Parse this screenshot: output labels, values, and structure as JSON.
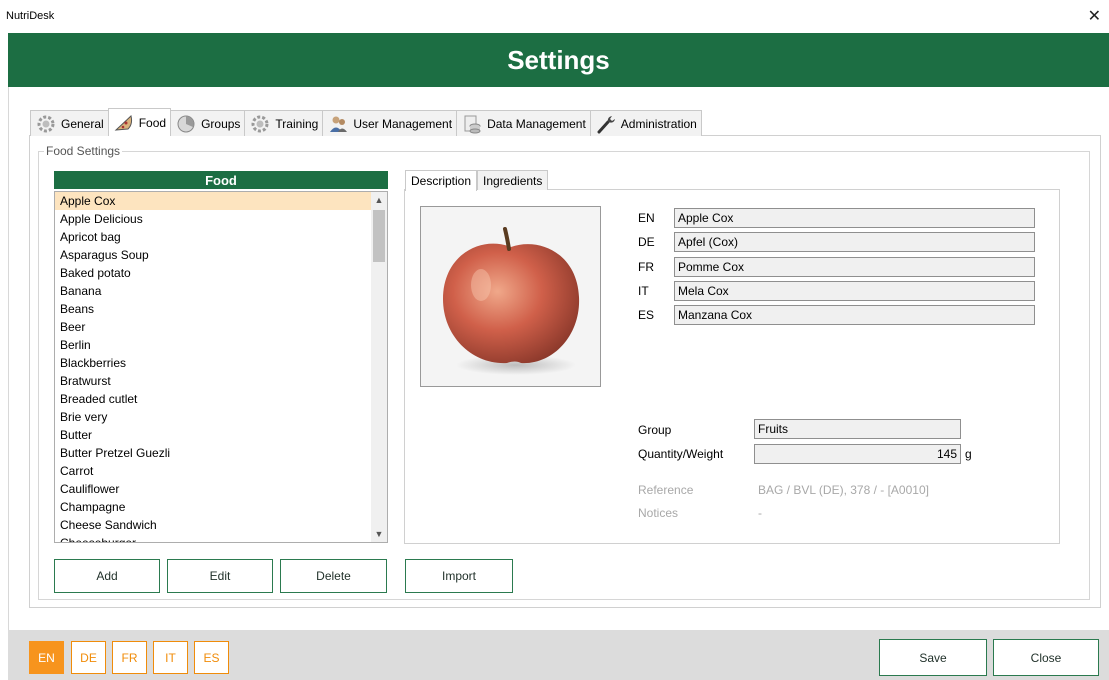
{
  "window": {
    "title": "NutriDesk",
    "close_glyph": "✕"
  },
  "header": {
    "title": "Settings"
  },
  "tabs": [
    {
      "label": "General",
      "icon": "gear-icon"
    },
    {
      "label": "Food",
      "icon": "pizza-icon"
    },
    {
      "label": "Groups",
      "icon": "pie-chart-icon"
    },
    {
      "label": "Training",
      "icon": "gear-icon"
    },
    {
      "label": "User Management",
      "icon": "users-icon"
    },
    {
      "label": "Data Management",
      "icon": "database-icon"
    },
    {
      "label": "Administration",
      "icon": "wrench-icon"
    }
  ],
  "active_tab": "Food",
  "food_settings": {
    "legend": "Food Settings",
    "list_header": "Food",
    "items": [
      "Apple Cox",
      "Apple Delicious",
      "Apricot bag",
      "Asparagus Soup",
      "Baked potato",
      "Banana",
      "Beans",
      "Beer",
      "Berlin",
      "Blackberries",
      "Bratwurst",
      "Breaded cutlet",
      "Brie very",
      "Butter",
      "Butter Pretzel Guezli",
      "Carrot",
      "Cauliflower",
      "Champagne",
      "Cheese Sandwich",
      "Cheeseburger"
    ],
    "selected_item": "Apple Cox",
    "buttons": {
      "add": "Add",
      "edit": "Edit",
      "delete": "Delete",
      "import": "Import"
    }
  },
  "detail": {
    "subtabs": [
      "Description",
      "Ingredients"
    ],
    "active_subtab": "Description",
    "names": [
      {
        "lang": "EN",
        "value": "Apple Cox"
      },
      {
        "lang": "DE",
        "value": "Apfel (Cox)"
      },
      {
        "lang": "FR",
        "value": "Pomme Cox"
      },
      {
        "lang": "IT",
        "value": "Mela Cox"
      },
      {
        "lang": "ES",
        "value": "Manzana Cox"
      }
    ],
    "group_label": "Group",
    "group_value": "Fruits",
    "quantity_label": "Quantity/Weight",
    "quantity_value": "145",
    "quantity_unit": "g",
    "reference_label": "Reference",
    "reference_value": "BAG / BVL (DE), 378 / - [A0010]",
    "notices_label": "Notices",
    "notices_value": "-"
  },
  "footer": {
    "languages": [
      "EN",
      "DE",
      "FR",
      "IT",
      "ES"
    ],
    "active_language": "EN",
    "save": "Save",
    "close": "Close"
  },
  "colors": {
    "brand_green": "#1c6e43",
    "accent_orange": "#f7941d",
    "selection": "#fde4bf"
  }
}
